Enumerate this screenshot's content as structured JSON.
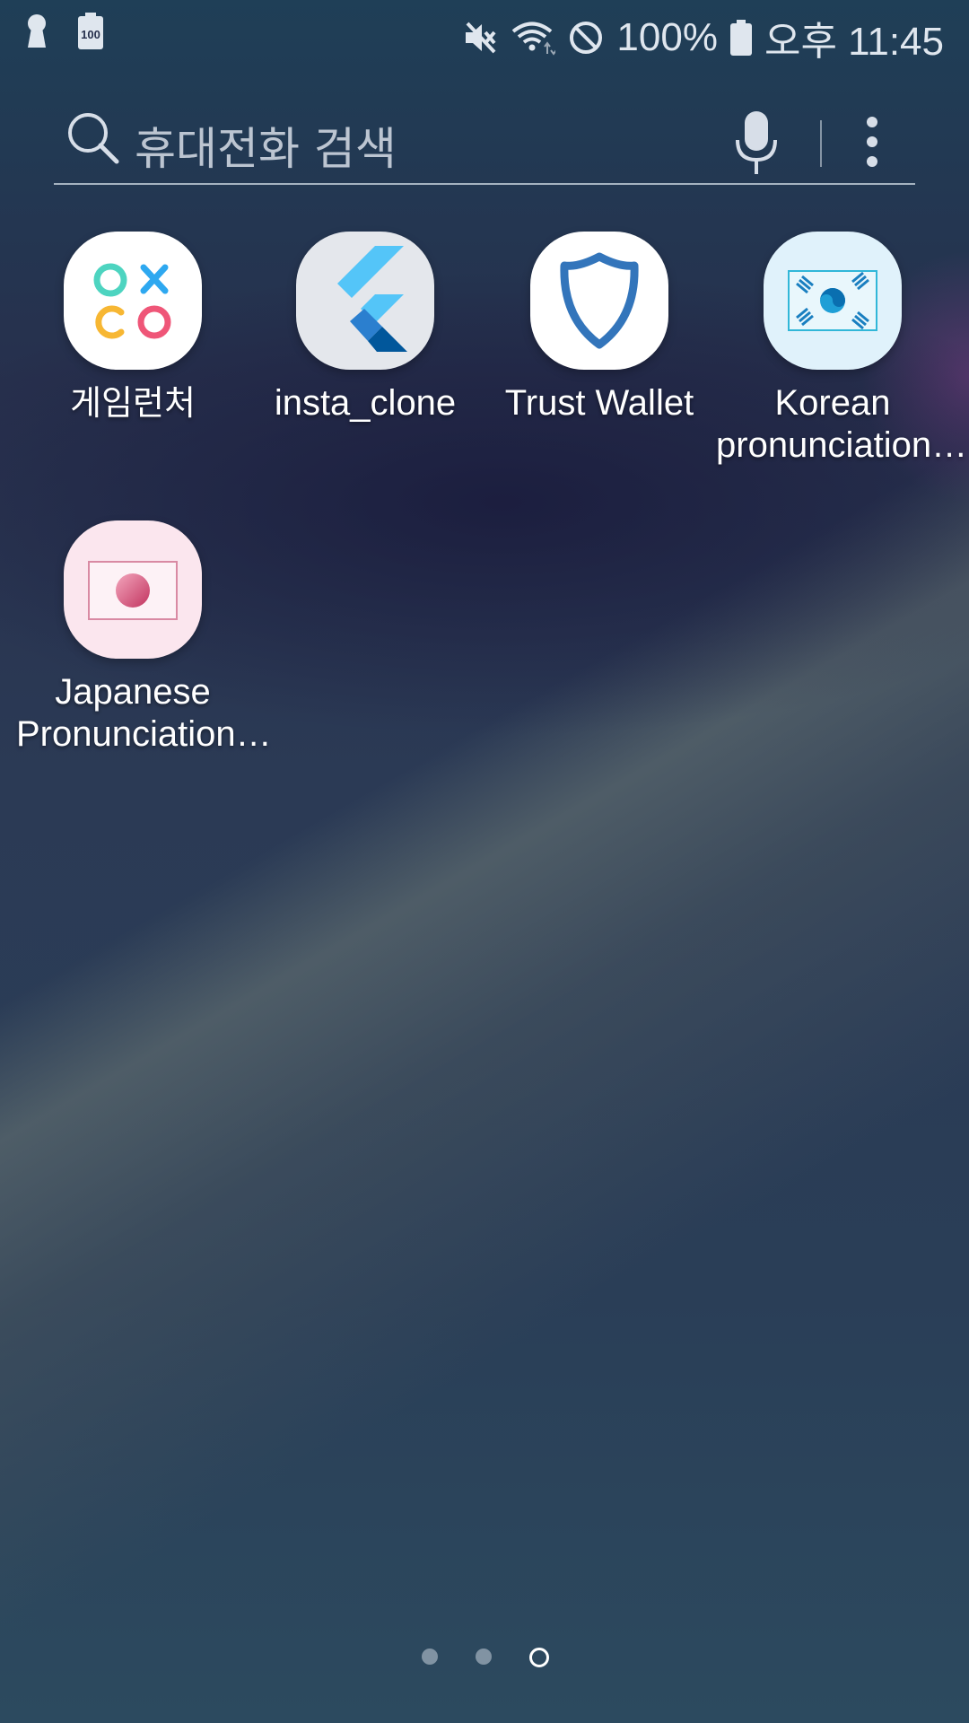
{
  "status_bar": {
    "left_icons": [
      "keyhole-icon",
      "battery-100-icon"
    ],
    "battery_small_label": "100",
    "right_icons": [
      "mute-icon",
      "wifi-icon",
      "do-not-disturb-icon",
      "battery-icon"
    ],
    "battery_percent": "100%",
    "time": "오후 11:45"
  },
  "search": {
    "placeholder": "휴대전화 검색",
    "icons": [
      "search-icon",
      "microphone-icon",
      "more-options-icon"
    ]
  },
  "apps": [
    {
      "label": "게임런처",
      "icon": "game-launcher-icon"
    },
    {
      "label": "insta_clone",
      "icon": "flutter-icon"
    },
    {
      "label": "Trust Wallet",
      "icon": "shield-icon"
    },
    {
      "label": "Korean\npronunciation…",
      "icon": "korean-flag-icon"
    },
    {
      "label": "Japanese\nPronunciation…",
      "icon": "japanese-flag-icon"
    }
  ],
  "page_indicator": {
    "pages": 3,
    "current": 3
  },
  "colors": {
    "flutter_light": "#54c5f8",
    "flutter_dark": "#01579b",
    "trust_blue": "#3375bb",
    "korean_icon_bg": "#e0f2fb",
    "japanese_icon_bg": "#fbe6ee"
  }
}
